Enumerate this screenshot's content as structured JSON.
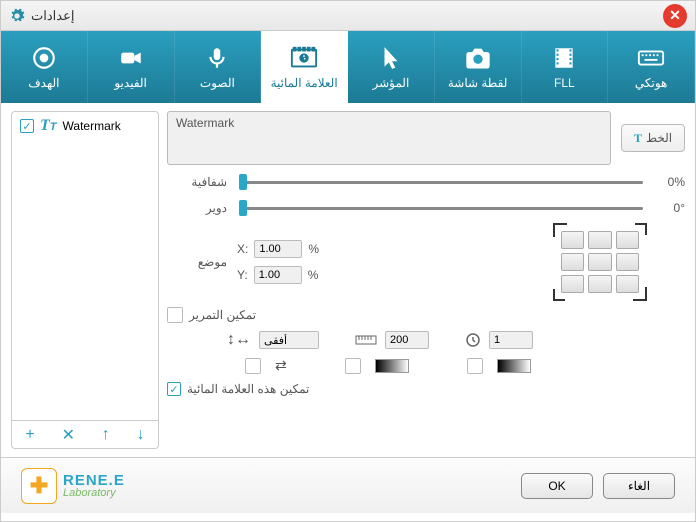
{
  "window_title": "إعدادات",
  "tabs": [
    {
      "label": "الهدف"
    },
    {
      "label": "الفيديو"
    },
    {
      "label": "الصوت"
    },
    {
      "label": "العلامة المائية"
    },
    {
      "label": "المؤشر"
    },
    {
      "label": "لقطة شاشة"
    },
    {
      "label": "FLL"
    },
    {
      "label": "هوتكي"
    }
  ],
  "watermark_list": [
    {
      "name": "Watermark",
      "checked": true
    }
  ],
  "preview_text": "Watermark",
  "font_btn": "الخط",
  "opacity": {
    "label": "شفافية",
    "value": "0%"
  },
  "rotate": {
    "label": "دوير",
    "value": "0°"
  },
  "position": {
    "label": "موضع",
    "x_label": "X:",
    "x_value": "1.00",
    "y_label": "Y:",
    "y_value": "1.00",
    "pct": "%"
  },
  "enable_scroll": "تمكين التمرير",
  "direction_value": "أفقى",
  "scroll_px": "200",
  "scroll_time": "1",
  "enable_watermark": "تمكين هذه العلامة المائية",
  "logo": {
    "brand": "RENE.E",
    "sub": "Laboratory"
  },
  "buttons": {
    "ok": "OK",
    "cancel": "الغاء"
  }
}
